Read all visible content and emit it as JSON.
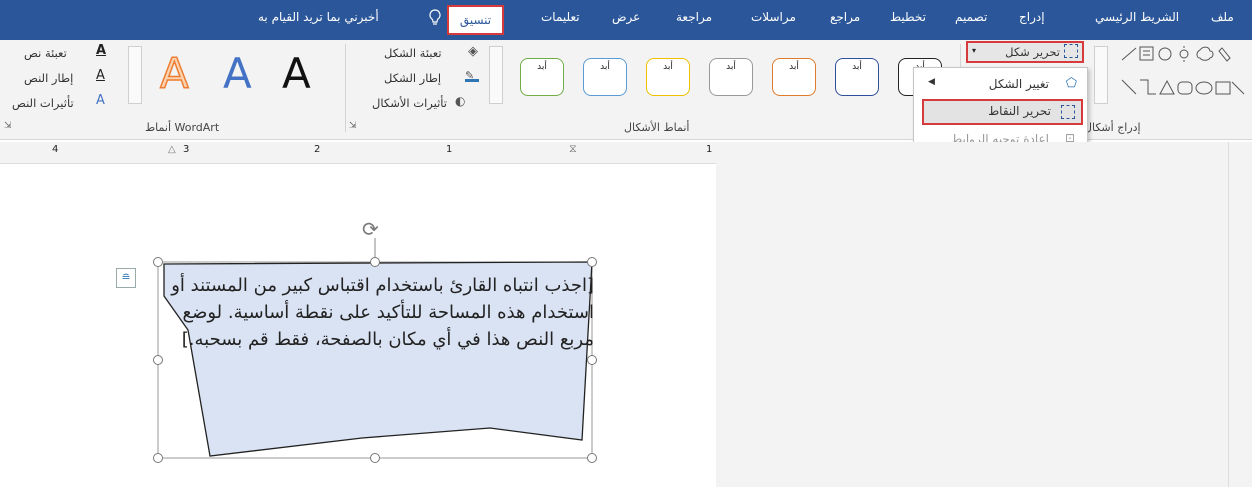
{
  "tabs": {
    "file": "ملف",
    "home": "الشريط الرئيسي",
    "insert": "إدراج",
    "design": "تصميم",
    "layout": "تخطيط",
    "references": "مراجع",
    "mailings": "مراسلات",
    "review": "مراجعة",
    "view": "عرض",
    "help": "تعليمات",
    "format": "تنسيق"
  },
  "tell_me": "أخبرني بما تريد القيام به",
  "ribbon": {
    "insert_shapes": {
      "label": "إدراج أشكال",
      "edit_shape": "تحرير شكل"
    },
    "shape_styles": {
      "label": "أنماط الأشكال",
      "sample": "أبد",
      "fill": "تعبئة الشكل",
      "outline": "إطار الشكل",
      "effects": "تأثيرات الأشكال"
    },
    "wordart": {
      "label": "أنماط WordArt",
      "letter": "A",
      "text_fill": "تعبئة نص",
      "text_outline": "إطار النص",
      "text_effects": "تأثيرات النص"
    }
  },
  "edit_shape_menu": {
    "change_shape": "تغيير الشكل",
    "edit_points": "تحرير النقاط",
    "reroute": "إعادة توجيه الروابط"
  },
  "ruler": {
    "n4": "4",
    "n3": "3",
    "n2": "2",
    "n1a": "1",
    "n1b": "1"
  },
  "document": {
    "body": "[اجذب انتباه القارئ باستخدام اقتباس كبير من المستند أو استخدام هذه المساحة للتأكيد على نقطة أساسية. لوضع مربع النص هذا في أي مكان بالصفحة، فقط قم بسحبه.]"
  },
  "colors": {
    "tab_bar": "#2b579a",
    "highlight": "#d63a3a",
    "shape_fill": "#dae3f3"
  }
}
